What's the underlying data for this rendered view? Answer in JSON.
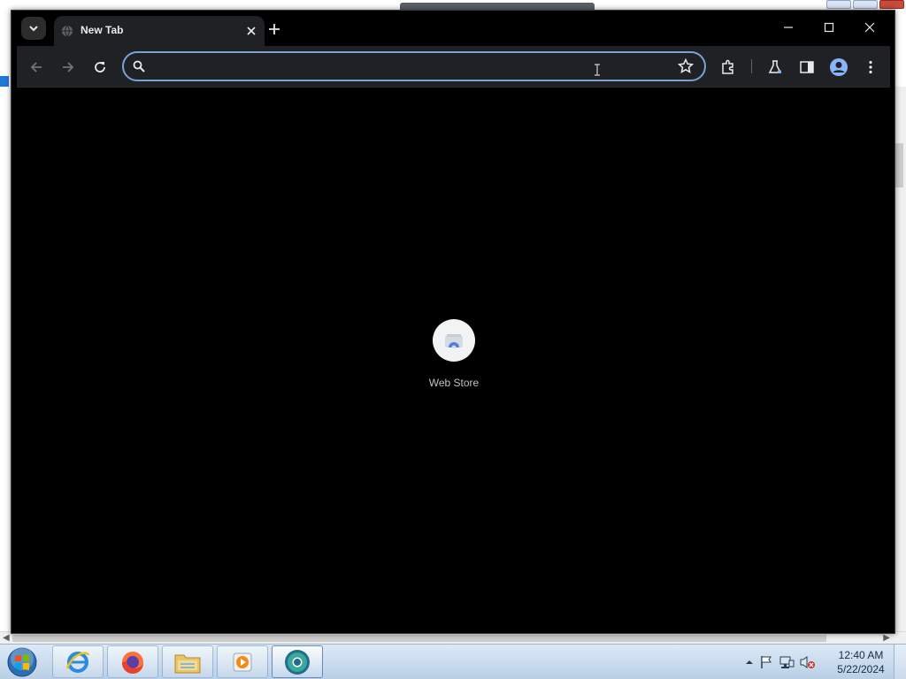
{
  "browser": {
    "tab": {
      "title": "New Tab"
    },
    "omnibox": {
      "value": "",
      "placeholder": ""
    },
    "new_tab_page": {
      "shortcuts": [
        {
          "label": "Web Store"
        }
      ]
    },
    "accent_color": "#7ca0d8",
    "theme": "dark"
  },
  "taskbar": {
    "items": [
      {
        "name": "internet-explorer"
      },
      {
        "name": "firefox"
      },
      {
        "name": "file-explorer"
      },
      {
        "name": "media-player"
      },
      {
        "name": "chrome-beta"
      }
    ],
    "clock": {
      "time": "12:40 AM",
      "date": "5/22/2024"
    }
  }
}
